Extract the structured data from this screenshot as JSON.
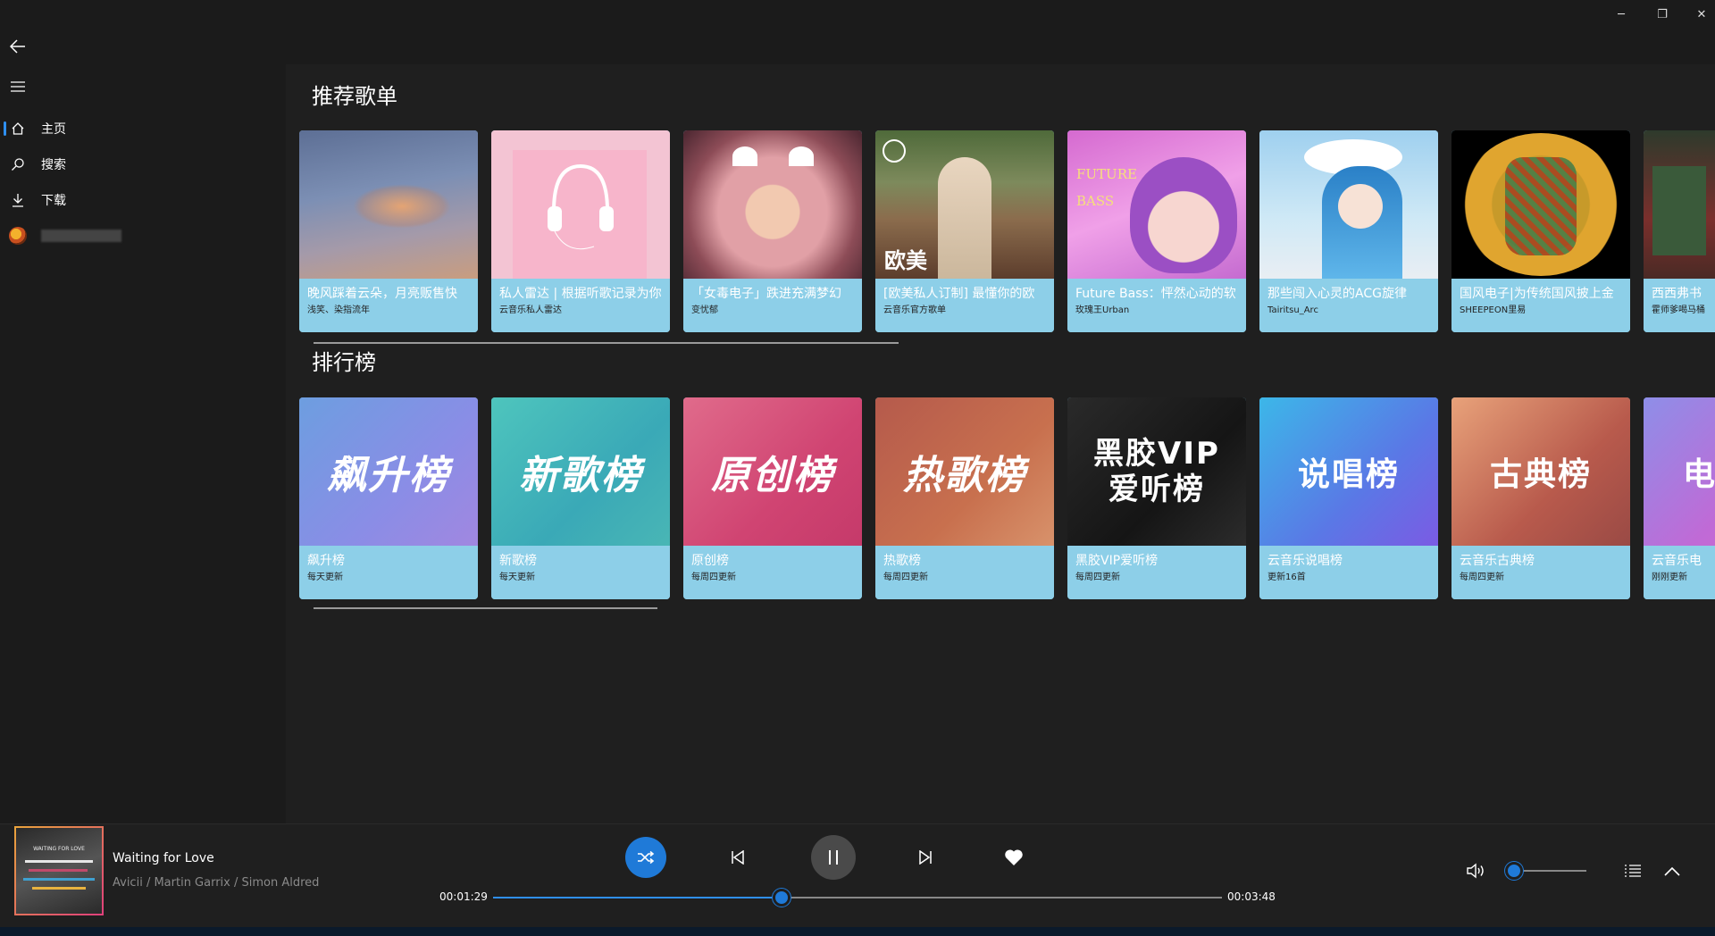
{
  "window": {
    "minimize_glyph": "─",
    "restore_glyph": "❐",
    "close_glyph": "✕"
  },
  "sidebar": {
    "items": [
      {
        "label": "主页",
        "icon": "home-icon",
        "active": true
      },
      {
        "label": "搜索",
        "icon": "search-icon",
        "active": false
      },
      {
        "label": "下载",
        "icon": "download-icon",
        "active": false
      }
    ]
  },
  "sections": {
    "recommended_title": "推荐歌单",
    "charts_title": "排行榜"
  },
  "playlists": [
    {
      "title": "晚风踩着云朵，月亮贩售快",
      "sub": "浅笑、染指流年"
    },
    {
      "title": "私人雷达 | 根据听歌记录为你",
      "sub": "云音乐私人雷达"
    },
    {
      "title": "「女毒电子」跌进充满梦幻",
      "sub": "变忧郁"
    },
    {
      "title": "[欧美私人订制] 最懂你的欧",
      "sub": "云音乐官方歌单",
      "art_text": "欧美"
    },
    {
      "title": "Future Bass：怦然心动的软",
      "sub": "玫瑰王Urban",
      "art_text": "FUTURE BASS"
    },
    {
      "title": "那些闯入心灵的ACG旋律",
      "sub": "Tairitsu_Arc"
    },
    {
      "title": "国风电子|为传统国风披上金",
      "sub": "SHEEPEON里易"
    },
    {
      "title": "西西弗书",
      "sub": "霍师爹喝马桶"
    }
  ],
  "charts": [
    {
      "title": "飙升榜",
      "sub": "每天更新",
      "art_text": "飙升榜"
    },
    {
      "title": "新歌榜",
      "sub": "每天更新",
      "art_text": "新歌榜"
    },
    {
      "title": "原创榜",
      "sub": "每周四更新",
      "art_text": "原创榜"
    },
    {
      "title": "热歌榜",
      "sub": "每周四更新",
      "art_text": "热歌榜"
    },
    {
      "title": "黑胶VIP爱听榜",
      "sub": "每周四更新",
      "art_text": "黑胶VIP 爱听榜"
    },
    {
      "title": "云音乐说唱榜",
      "sub": "更新16首",
      "art_text": "说唱榜"
    },
    {
      "title": "云音乐古典榜",
      "sub": "每周四更新",
      "art_text": "古典榜"
    },
    {
      "title": "云音乐电",
      "sub": "刚刚更新",
      "art_text": "电"
    }
  ],
  "player": {
    "track_title": "Waiting for Love",
    "artists": "Avicii / Martin Garrix / Simon Aldred",
    "album_art_text": "WAITING FOR LOVE",
    "elapsed": "00:01:29",
    "duration": "00:03:48",
    "progress_fraction": 0.396,
    "volume_fraction": 0.1,
    "accent": "#2f8ff0"
  }
}
